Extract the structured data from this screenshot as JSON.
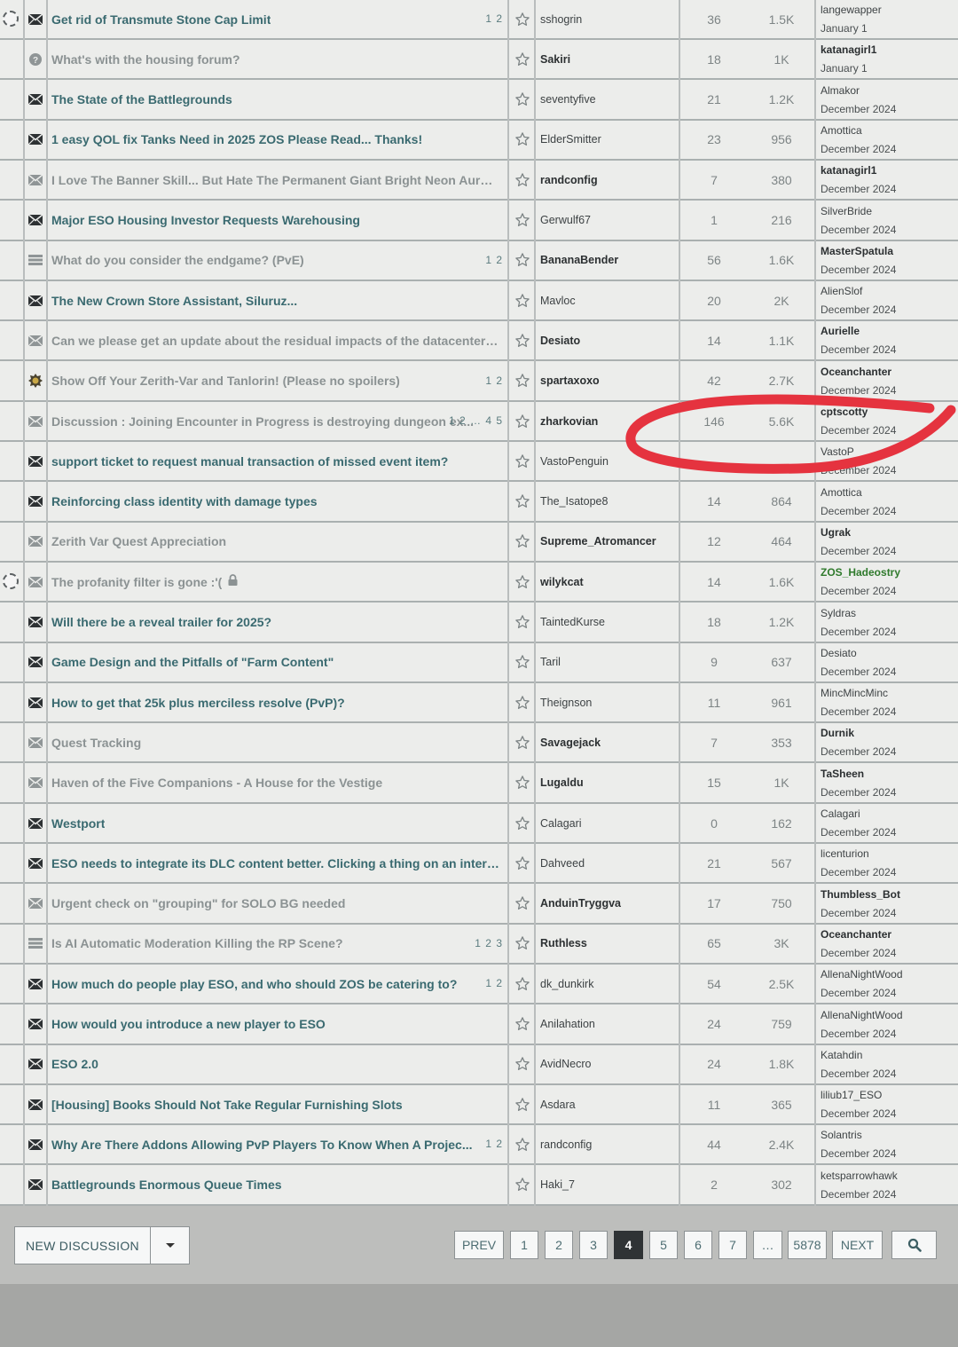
{
  "rows": [
    {
      "title": "Get rid of Transmute Stone Cap Limit",
      "read": false,
      "icon": "envelope-icon",
      "avatar": "ring",
      "pages": "1 2",
      "starter": "sshogrin",
      "starter_bold": false,
      "replies": "36",
      "views": "1.5K",
      "last_user": "langewapper",
      "last_style": "normal",
      "last_date": "January 1"
    },
    {
      "title": "What's with the housing forum?",
      "read": true,
      "icon": "question-icon",
      "avatar": "",
      "pages": "",
      "starter": "Sakiri",
      "starter_bold": true,
      "replies": "18",
      "views": "1K",
      "last_user": "katanagirl1",
      "last_style": "bold",
      "last_date": "January 1"
    },
    {
      "title": "The State of the Battlegrounds",
      "read": false,
      "icon": "envelope-icon",
      "avatar": "",
      "pages": "",
      "starter": "seventyfive",
      "starter_bold": false,
      "replies": "21",
      "views": "1.2K",
      "last_user": "Almakor",
      "last_style": "normal",
      "last_date": "December 2024"
    },
    {
      "title": "1 easy QOL fix Tanks Need in 2025 ZOS Please Read... Thanks!",
      "read": false,
      "icon": "envelope-icon",
      "avatar": "",
      "pages": "",
      "starter": "ElderSmitter",
      "starter_bold": false,
      "replies": "23",
      "views": "956",
      "last_user": "Amottica",
      "last_style": "normal",
      "last_date": "December 2024"
    },
    {
      "title": "I Love The Banner Skill... But Hate The Permanent Giant Bright Neon Aura Effect...",
      "read": true,
      "icon": "envelope-icon",
      "avatar": "",
      "pages": "",
      "starter": "randconfig",
      "starter_bold": true,
      "replies": "7",
      "views": "380",
      "last_user": "katanagirl1",
      "last_style": "bold",
      "last_date": "December 2024"
    },
    {
      "title": "Major ESO Housing Investor Requests Warehousing",
      "read": false,
      "icon": "envelope-icon",
      "avatar": "",
      "pages": "",
      "starter": "Gerwulf67",
      "starter_bold": false,
      "replies": "1",
      "views": "216",
      "last_user": "SilverBride",
      "last_style": "normal",
      "last_date": "December 2024"
    },
    {
      "title": "What do you consider the endgame? (PvE)",
      "read": true,
      "icon": "list-icon",
      "avatar": "",
      "pages": "1 2",
      "starter": "BananaBender",
      "starter_bold": true,
      "replies": "56",
      "views": "1.6K",
      "last_user": "MasterSpatula",
      "last_style": "bold",
      "last_date": "December 2024"
    },
    {
      "title": "The New Crown Store Assistant, Siluruz...",
      "read": false,
      "icon": "envelope-icon",
      "avatar": "",
      "pages": "",
      "starter": "Mavloc",
      "starter_bold": false,
      "replies": "20",
      "views": "2K",
      "last_user": "AlienSlof",
      "last_style": "normal",
      "last_date": "December 2024"
    },
    {
      "title": "Can we please get an update about the residual impacts of the datacenter outage?",
      "read": true,
      "icon": "envelope-icon",
      "avatar": "",
      "pages": "",
      "starter": "Desiato",
      "starter_bold": true,
      "replies": "14",
      "views": "1.1K",
      "last_user": "Aurielle",
      "last_style": "bold",
      "last_date": "December 2024"
    },
    {
      "title": "Show Off Your Zerith-Var and Tanlorin! (Please no spoilers)",
      "read": true,
      "icon": "badge-icon",
      "avatar": "",
      "pages": "1 2",
      "starter": "spartaxoxo",
      "starter_bold": true,
      "replies": "42",
      "views": "2.7K",
      "last_user": "Oceanchanter",
      "last_style": "bold",
      "last_date": "December 2024"
    },
    {
      "title": "Discussion : Joining Encounter in Progress is destroying dungeon ex...",
      "read": true,
      "icon": "envelope-icon",
      "avatar": "",
      "pages": "1 2 … 4 5",
      "starter": "zharkovian",
      "starter_bold": true,
      "replies": "146",
      "views": "5.6K",
      "last_user": "cptscotty",
      "last_style": "bold",
      "last_date": "December 2024"
    },
    {
      "title": "support ticket to request manual transaction of missed event item?",
      "read": false,
      "icon": "envelope-icon",
      "avatar": "",
      "pages": "",
      "starter": "VastoPenguin",
      "starter_bold": false,
      "replies": "",
      "views": "",
      "last_user": "VastoP",
      "last_style": "normal",
      "last_date": "December 2024"
    },
    {
      "title": "Reinforcing class identity with damage types",
      "read": false,
      "icon": "envelope-icon",
      "avatar": "",
      "pages": "",
      "starter": "The_Isatope8",
      "starter_bold": false,
      "replies": "14",
      "views": "864",
      "last_user": "Amottica",
      "last_style": "normal",
      "last_date": "December 2024"
    },
    {
      "title": "Zerith Var Quest Appreciation",
      "read": true,
      "icon": "envelope-icon",
      "avatar": "",
      "pages": "",
      "starter": "Supreme_Atromancer",
      "starter_bold": true,
      "replies": "12",
      "views": "464",
      "last_user": "Ugrak",
      "last_style": "bold",
      "last_date": "December 2024"
    },
    {
      "title": "The profanity filter is gone :'(",
      "read": true,
      "icon": "envelope-icon",
      "avatar": "ring",
      "pages": "",
      "locked": true,
      "starter": "wilykcat",
      "starter_bold": true,
      "replies": "14",
      "views": "1.6K",
      "last_user": "ZOS_Hadeostry",
      "last_style": "mod",
      "last_date": "December 2024"
    },
    {
      "title": "Will there be a reveal trailer for 2025?",
      "read": false,
      "icon": "envelope-icon",
      "avatar": "",
      "pages": "",
      "starter": "TaintedKurse",
      "starter_bold": false,
      "replies": "18",
      "views": "1.2K",
      "last_user": "Syldras",
      "last_style": "normal",
      "last_date": "December 2024"
    },
    {
      "title": "Game Design and the Pitfalls of \"Farm Content\"",
      "read": false,
      "icon": "envelope-icon",
      "avatar": "",
      "pages": "",
      "starter": "Taril",
      "starter_bold": false,
      "replies": "9",
      "views": "637",
      "last_user": "Desiato",
      "last_style": "normal",
      "last_date": "December 2024"
    },
    {
      "title": "How to get that 25k plus merciless resolve (PvP)?",
      "read": false,
      "icon": "envelope-icon",
      "avatar": "",
      "pages": "",
      "starter": "Theignson",
      "starter_bold": false,
      "replies": "11",
      "views": "961",
      "last_user": "MincMincMinc",
      "last_style": "normal",
      "last_date": "December 2024"
    },
    {
      "title": "Quest Tracking",
      "read": true,
      "icon": "envelope-icon",
      "avatar": "",
      "pages": "",
      "starter": "Savagejack",
      "starter_bold": true,
      "replies": "7",
      "views": "353",
      "last_user": "Durnik",
      "last_style": "bold",
      "last_date": "December 2024"
    },
    {
      "title": "Haven of the Five Companions - A House for the Vestige",
      "read": true,
      "icon": "envelope-icon",
      "avatar": "",
      "pages": "",
      "starter": "Lugaldu",
      "starter_bold": true,
      "replies": "15",
      "views": "1K",
      "last_user": "TaSheen",
      "last_style": "bold",
      "last_date": "December 2024"
    },
    {
      "title": "Westport",
      "read": false,
      "icon": "envelope-icon",
      "avatar": "",
      "pages": "",
      "starter": "Calagari",
      "starter_bold": false,
      "replies": "0",
      "views": "162",
      "last_user": "Calagari",
      "last_style": "normal",
      "last_date": "December 2024"
    },
    {
      "title": "ESO needs to integrate its DLC content better. Clicking a thing on an interface isn'...",
      "read": false,
      "icon": "envelope-icon",
      "avatar": "",
      "pages": "",
      "starter": "Dahveed",
      "starter_bold": false,
      "replies": "21",
      "views": "567",
      "last_user": "licenturion",
      "last_style": "normal",
      "last_date": "December 2024"
    },
    {
      "title": "Urgent check on \"grouping\" for SOLO BG needed",
      "read": true,
      "icon": "envelope-icon",
      "avatar": "",
      "pages": "",
      "starter": "AnduinTryggva",
      "starter_bold": true,
      "replies": "17",
      "views": "750",
      "last_user": "Thumbless_Bot",
      "last_style": "bold",
      "last_date": "December 2024"
    },
    {
      "title": "Is AI Automatic Moderation Killing the RP Scene?",
      "read": true,
      "icon": "list-icon",
      "avatar": "",
      "pages": "1 2 3",
      "starter": "Ruthless",
      "starter_bold": true,
      "replies": "65",
      "views": "3K",
      "last_user": "Oceanchanter",
      "last_style": "bold",
      "last_date": "December 2024"
    },
    {
      "title": "How much do people play ESO, and who should ZOS be catering to?",
      "read": false,
      "icon": "envelope-icon",
      "avatar": "",
      "pages": "1 2",
      "starter": "dk_dunkirk",
      "starter_bold": false,
      "replies": "54",
      "views": "2.5K",
      "last_user": "AllenaNightWood",
      "last_style": "normal",
      "last_date": "December 2024"
    },
    {
      "title": "How would you introduce a new player to ESO",
      "read": false,
      "icon": "envelope-icon",
      "avatar": "",
      "pages": "",
      "starter": "Anilahation",
      "starter_bold": false,
      "replies": "24",
      "views": "759",
      "last_user": "AllenaNightWood",
      "last_style": "normal",
      "last_date": "December 2024"
    },
    {
      "title": "ESO 2.0",
      "read": false,
      "icon": "envelope-icon",
      "avatar": "",
      "pages": "",
      "starter": "AvidNecro",
      "starter_bold": false,
      "replies": "24",
      "views": "1.8K",
      "last_user": "Katahdin",
      "last_style": "normal",
      "last_date": "December 2024"
    },
    {
      "title": "[Housing] Books Should Not Take Regular Furnishing Slots",
      "read": false,
      "icon": "envelope-icon",
      "avatar": "",
      "pages": "",
      "starter": "Asdara",
      "starter_bold": false,
      "replies": "11",
      "views": "365",
      "last_user": "liliub17_ESO",
      "last_style": "normal",
      "last_date": "December 2024"
    },
    {
      "title": "Why Are There Addons Allowing PvP Players To Know When A Projec...",
      "read": false,
      "icon": "envelope-icon",
      "avatar": "",
      "pages": "1 2",
      "starter": "randconfig",
      "starter_bold": false,
      "replies": "44",
      "views": "2.4K",
      "last_user": "Solantris",
      "last_style": "normal",
      "last_date": "December 2024"
    },
    {
      "title": "Battlegrounds Enormous Queue Times",
      "read": false,
      "icon": "envelope-icon",
      "avatar": "",
      "pages": "",
      "starter": "Haki_7",
      "starter_bold": false,
      "replies": "2",
      "views": "302",
      "last_user": "ketsparrowhawk",
      "last_style": "normal",
      "last_date": "December 2024"
    }
  ],
  "footer": {
    "new_discussion_label": "NEW DISCUSSION",
    "pagination": [
      "PREV",
      "1",
      "2",
      "3",
      "4",
      "5",
      "6",
      "7",
      "…",
      "5878",
      "NEXT"
    ],
    "current_page": "4"
  },
  "colors": {
    "annotation": "#e5333f",
    "unread_title": "#3a6a70",
    "read_title": "#8b9293"
  }
}
